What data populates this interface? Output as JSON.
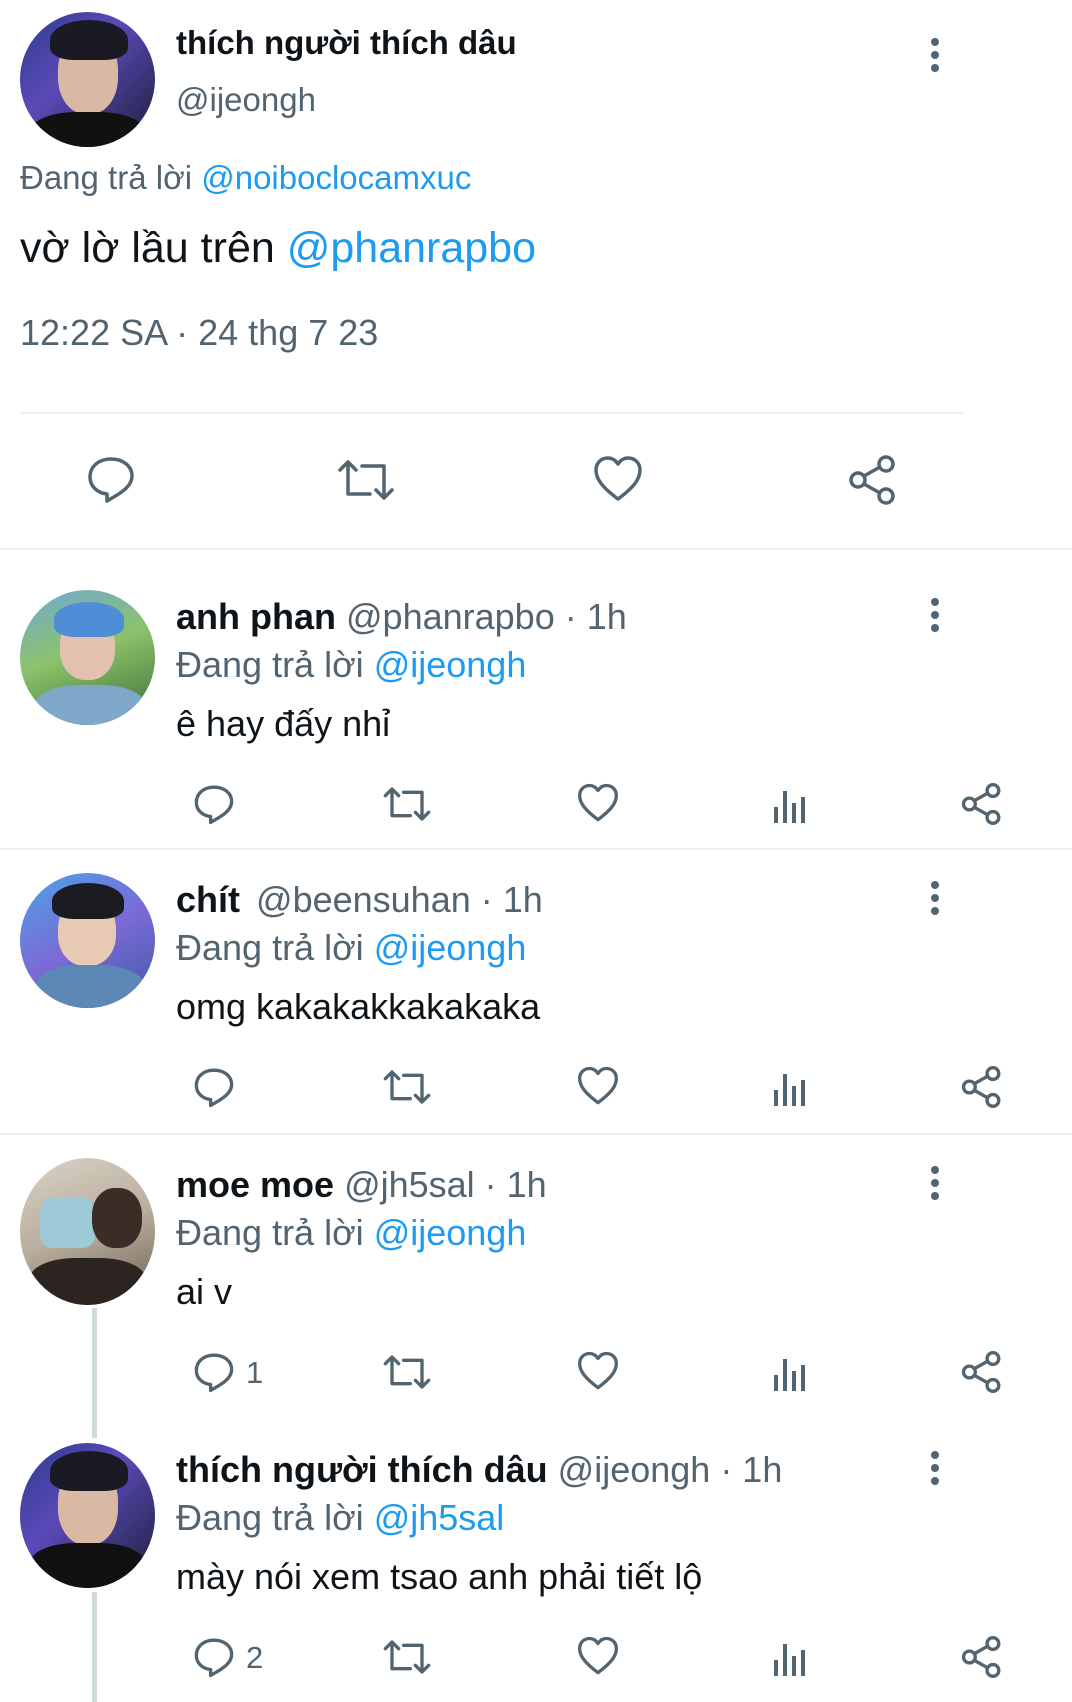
{
  "main_tweet": {
    "display_name": "thích người thích dâu",
    "handle": "@ijeongh",
    "replying_prefix": "Đang trả lời ",
    "replying_to": "@noiboclocamxuc",
    "text": "vờ lờ lầu trên ",
    "mention": "@phanrapbo",
    "timestamp": "12:22 SA · 24 thg 7 23",
    "actions": [
      "reply-icon",
      "retweet-icon",
      "like-icon",
      "share-icon"
    ]
  },
  "replies": [
    {
      "display_name": "anh phan",
      "handle": "@phanrapbo",
      "time": " · 1h",
      "replying_prefix": "Đang trả lời ",
      "replying_to": "@ijeongh",
      "text": "ê hay đấy nhỉ",
      "reply_count": ""
    },
    {
      "display_name": "chít",
      "handle": "@beensuhan",
      "time": " · 1h",
      "replying_prefix": "Đang trả lời ",
      "replying_to": "@ijeongh",
      "text": "omg kakakakkakakaka",
      "reply_count": ""
    },
    {
      "display_name": "moe moe",
      "handle": "@jh5sal",
      "time": " · 1h",
      "replying_prefix": "Đang trả lời ",
      "replying_to": "@ijeongh",
      "text": "ai v",
      "reply_count": "1"
    },
    {
      "display_name": "thích người thích dâu",
      "handle": "@ijeongh",
      "time": " · 1h",
      "replying_prefix": "Đang trả lời ",
      "replying_to": "@jh5sal",
      "text": "mày nói xem tsao anh phải tiết lộ",
      "reply_count": "2"
    }
  ],
  "colors": {
    "link": "#1d9bf0",
    "secondary": "#536471",
    "divider": "#eceff1"
  }
}
